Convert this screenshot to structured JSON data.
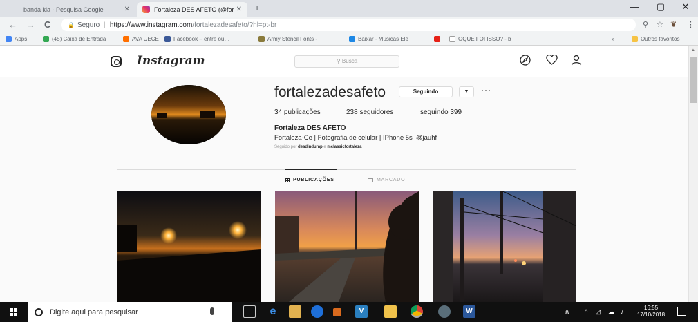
{
  "browser": {
    "tabs": [
      {
        "title": "banda kia - Pesquisa Google",
        "active": false
      },
      {
        "title": "Fortaleza DES AFETO (@fortalez…",
        "active": true
      }
    ],
    "new_tab_glyph": "+",
    "window_controls": [
      "—",
      "▢",
      "✕"
    ],
    "nav": {
      "back": "←",
      "forward": "→",
      "reload": "C"
    },
    "address": {
      "secure_label": "Seguro",
      "url_host": "https://www.instagram.com",
      "url_path": "/fortalezadesafeto/?hl=pt-br"
    },
    "bookmarks": [
      {
        "label": "Apps",
        "icon": "apps-grid-icon",
        "color": "#4285f4"
      },
      {
        "label": "(45) Caixa de Entrada",
        "icon": "google-icon",
        "color": "#4285f4"
      },
      {
        "label": "AVA UECE",
        "icon": "ava-icon",
        "color": "#ff6f00"
      },
      {
        "label": "Facebook – entre ou…",
        "icon": "facebook-icon",
        "color": "#3b5998"
      },
      {
        "label": "Army Stencil Fonts -",
        "icon": "army-icon",
        "color": "#8a7b3c"
      },
      {
        "label": "Baixar - Musicas Ele",
        "icon": "download-icon",
        "color": "#1e88e5"
      },
      {
        "label": "",
        "icon": "youtube-icon",
        "color": "#e62117"
      },
      {
        "label": "OQUE FOI ISSO? - b",
        "icon": "page-icon",
        "color": "#9e9e9e"
      }
    ],
    "other_bookmarks": "Outros favoritos"
  },
  "instagram": {
    "logo_text": "Instagram",
    "search_placeholder": "Busca",
    "nav_icons": [
      "compass-icon",
      "heart-icon",
      "profile-icon"
    ]
  },
  "profile": {
    "username": "fortalezadesafeto",
    "follow_button": "Seguindo",
    "stats": {
      "posts": "34 publicações",
      "followers": "238 seguidores",
      "following": "seguindo 399"
    },
    "full_name": "Fortaleza DES AFETO",
    "bio": "Fortaleza-Ce | Fotografia de celular | IPhone 5s |@jauhf",
    "followed_by_prefix": "Seguido por",
    "followed_by_names": "deadindump",
    "followed_by_joiner": "e",
    "followed_by_names2": "mclassicfortaleza",
    "tabs": [
      {
        "label": "PUBLICAÇÕES",
        "active": true
      },
      {
        "label": "MARCADO",
        "active": false
      }
    ]
  },
  "taskbar": {
    "search_placeholder": "Digite aqui para pesquisar",
    "time": "16:55",
    "date": "17/10/2018"
  }
}
